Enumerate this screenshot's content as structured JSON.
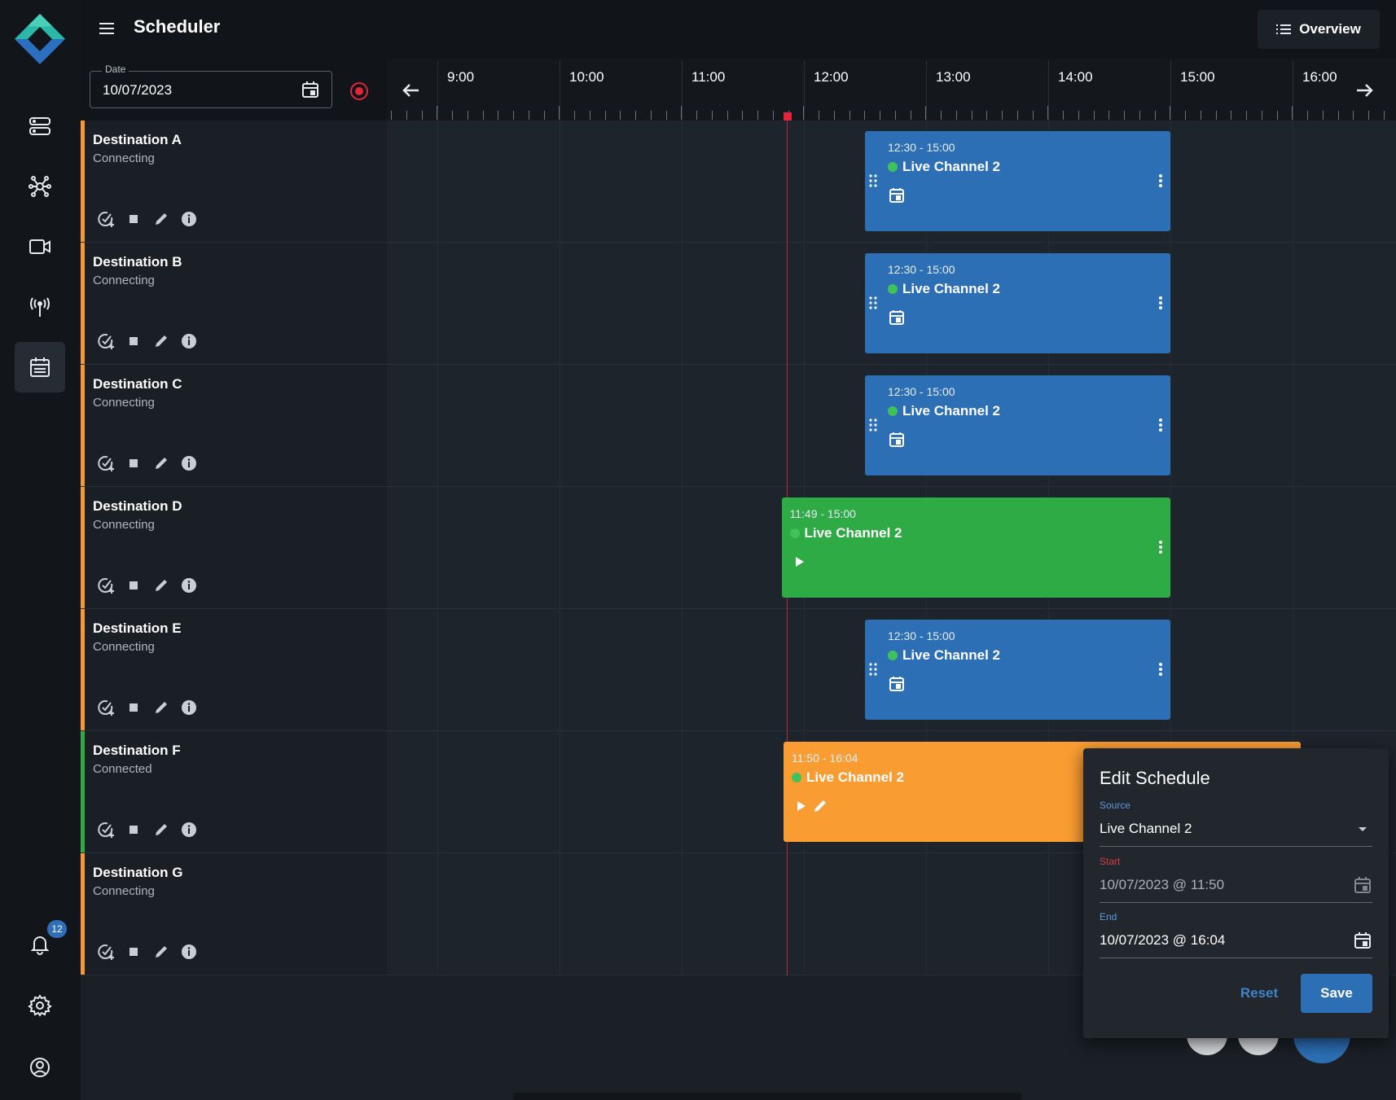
{
  "header": {
    "title": "Scheduler",
    "overview_label": "Overview"
  },
  "date_picker": {
    "label": "Date",
    "value": "10/07/2023"
  },
  "timeline": {
    "hours": [
      "9:00",
      "10:00",
      "11:00",
      "12:00",
      "13:00",
      "14:00",
      "15:00",
      "16:00"
    ]
  },
  "notifications": {
    "count": "12"
  },
  "rows": [
    {
      "name": "Destination A",
      "status": "Connecting",
      "status_color": "#f59b2c"
    },
    {
      "name": "Destination B",
      "status": "Connecting",
      "status_color": "#f59b2c"
    },
    {
      "name": "Destination C",
      "status": "Connecting",
      "status_color": "#f59b2c"
    },
    {
      "name": "Destination D",
      "status": "Connecting",
      "status_color": "#f59b2c"
    },
    {
      "name": "Destination E",
      "status": "Connecting",
      "status_color": "#f59b2c"
    },
    {
      "name": "Destination F",
      "status": "Connected",
      "status_color": "#2eab45"
    },
    {
      "name": "Destination G",
      "status": "Connecting",
      "status_color": "#f59b2c"
    }
  ],
  "events": [
    {
      "row": 0,
      "time": "12:30 - 15:00",
      "title": "Live Channel 2",
      "color": "blue",
      "icon": "calendar-icon"
    },
    {
      "row": 1,
      "time": "12:30 - 15:00",
      "title": "Live Channel 2",
      "color": "blue",
      "icon": "calendar-icon"
    },
    {
      "row": 2,
      "time": "12:30 - 15:00",
      "title": "Live Channel 2",
      "color": "blue",
      "icon": "calendar-icon"
    },
    {
      "row": 3,
      "time": "11:49 - 15:00",
      "title": "Live Channel 2",
      "color": "green",
      "icon": "play-icon"
    },
    {
      "row": 4,
      "time": "12:30 - 15:00",
      "title": "Live Channel 2",
      "color": "blue",
      "icon": "calendar-icon"
    },
    {
      "row": 5,
      "time": "11:50 - 16:04",
      "title": "Live Channel 2",
      "color": "orange",
      "icon": "play-icon"
    }
  ],
  "dialog": {
    "title": "Edit Schedule",
    "source_label": "Source",
    "source_value": "Live Channel 2",
    "start_label": "Start",
    "start_value": "10/07/2023 @ 11:50",
    "end_label": "End",
    "end_value": "10/07/2023 @ 16:04",
    "reset_label": "Reset",
    "save_label": "Save"
  },
  "colors": {
    "accent_blue": "#2d6fb5",
    "live_green": "#2eab45",
    "active_orange": "#f99d33",
    "now_red": "#e0263a"
  }
}
